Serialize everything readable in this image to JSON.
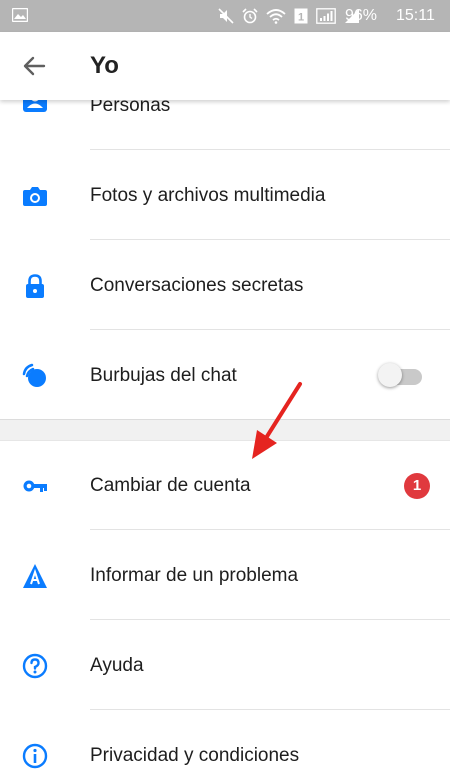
{
  "status_bar": {
    "battery": "96%",
    "time": "15:11",
    "sim_badge": "1"
  },
  "header": {
    "title": "Yo"
  },
  "menu": {
    "personas": "Personas",
    "fotos": "Fotos y archivos multimedia",
    "secretas": "Conversaciones secretas",
    "burbujas": "Burbujas del chat",
    "burbujas_toggle_on": false,
    "cambiar": "Cambiar de cuenta",
    "cambiar_badge": "1",
    "informar": "Informar de un problema",
    "ayuda": "Ayuda",
    "privacidad": "Privacidad y condiciones"
  },
  "colors": {
    "accent": "#0a7cff",
    "badge": "#e0393e",
    "arrow": "#e52420",
    "statusbar": "#b5b5b5"
  }
}
